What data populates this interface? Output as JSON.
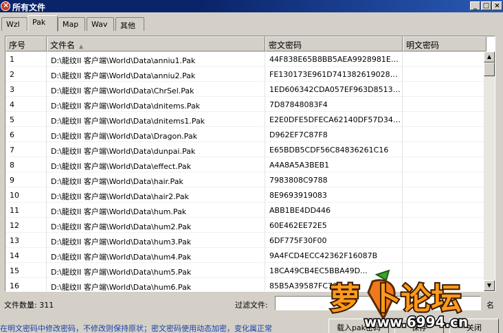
{
  "window": {
    "title": "所有文件"
  },
  "tabs": [
    {
      "label": "Wzl"
    },
    {
      "label": "Pak",
      "active": true
    },
    {
      "label": "Map"
    },
    {
      "label": "Wav"
    },
    {
      "label": "其他"
    }
  ],
  "table": {
    "columns": [
      "序号",
      "文件名",
      "密文密码",
      "明文密码"
    ],
    "rows": [
      [
        "1",
        "D:\\龍纹II 客户端\\World\\Data\\anniu1.Pak",
        "44F838E65B8BB5AEA9928981E702...",
        ""
      ],
      [
        "2",
        "D:\\龍纹II 客户端\\World\\Data\\anniu2.Pak",
        "FE130173E961D741382619028A08...",
        ""
      ],
      [
        "3",
        "D:\\龍纹II 客户端\\World\\Data\\ChrSel.Pak",
        "1ED606342CDA057EF963D85137D3...",
        ""
      ],
      [
        "4",
        "D:\\龍纹II 客户端\\World\\Data\\dnitems.Pak",
        "7D87848083F4",
        ""
      ],
      [
        "5",
        "D:\\龍纹II 客户端\\World\\Data\\dnitems1.Pak",
        "E2E0DFE5DFECA62140DF57D3403F...",
        ""
      ],
      [
        "6",
        "D:\\龍纹II 客户端\\World\\Data\\Dragon.Pak",
        "D962EF7C87F8",
        ""
      ],
      [
        "7",
        "D:\\龍纹II 客户端\\World\\Data\\dunpai.Pak",
        "E65BDB5CDF56C84836261C16",
        ""
      ],
      [
        "8",
        "D:\\龍纹II 客户端\\World\\Data\\effect.Pak",
        "A4A8A5A3BEB1",
        ""
      ],
      [
        "9",
        "D:\\龍纹II 客户端\\World\\Data\\hair.Pak",
        "7983808C9788",
        ""
      ],
      [
        "10",
        "D:\\龍纹II 客户端\\World\\Data\\hair2.Pak",
        "8E9693919083",
        ""
      ],
      [
        "11",
        "D:\\龍纹II 客户端\\World\\Data\\hum.Pak",
        "ABB1BE4DD446",
        ""
      ],
      [
        "12",
        "D:\\龍纹II 客户端\\World\\Data\\hum2.Pak",
        "60E462EE72E5",
        ""
      ],
      [
        "13",
        "D:\\龍纹II 客户端\\World\\Data\\hum3.Pak",
        "6DF775F30F00",
        ""
      ],
      [
        "14",
        "D:\\龍纹II 客户端\\World\\Data\\hum4.Pak",
        "9A4FCD4ECC42362F16087B",
        ""
      ],
      [
        "15",
        "D:\\龍纹II 客户端\\World\\Data\\hum5.Pak",
        "18CA49CB4EC5BBA49D...",
        ""
      ],
      [
        "16",
        "D:\\龍纹II 客户端\\World\\Data\\hum6.Pak",
        "85B5A39587FC73E...",
        ""
      ]
    ]
  },
  "status": {
    "count_label": "文件数量: 311"
  },
  "filter": {
    "label": "过滤文件:",
    "value": "",
    "name_suffix": "名"
  },
  "hint": "在明文密码中修改密码，不修改则保持原状；密文密码使用动态加密，变化属正常",
  "buttons": {
    "load": "载入pak密码",
    "save": "保存",
    "close": "关闭"
  },
  "watermark": {
    "brand": "萝卜论坛",
    "site": "www.6994.cn"
  }
}
